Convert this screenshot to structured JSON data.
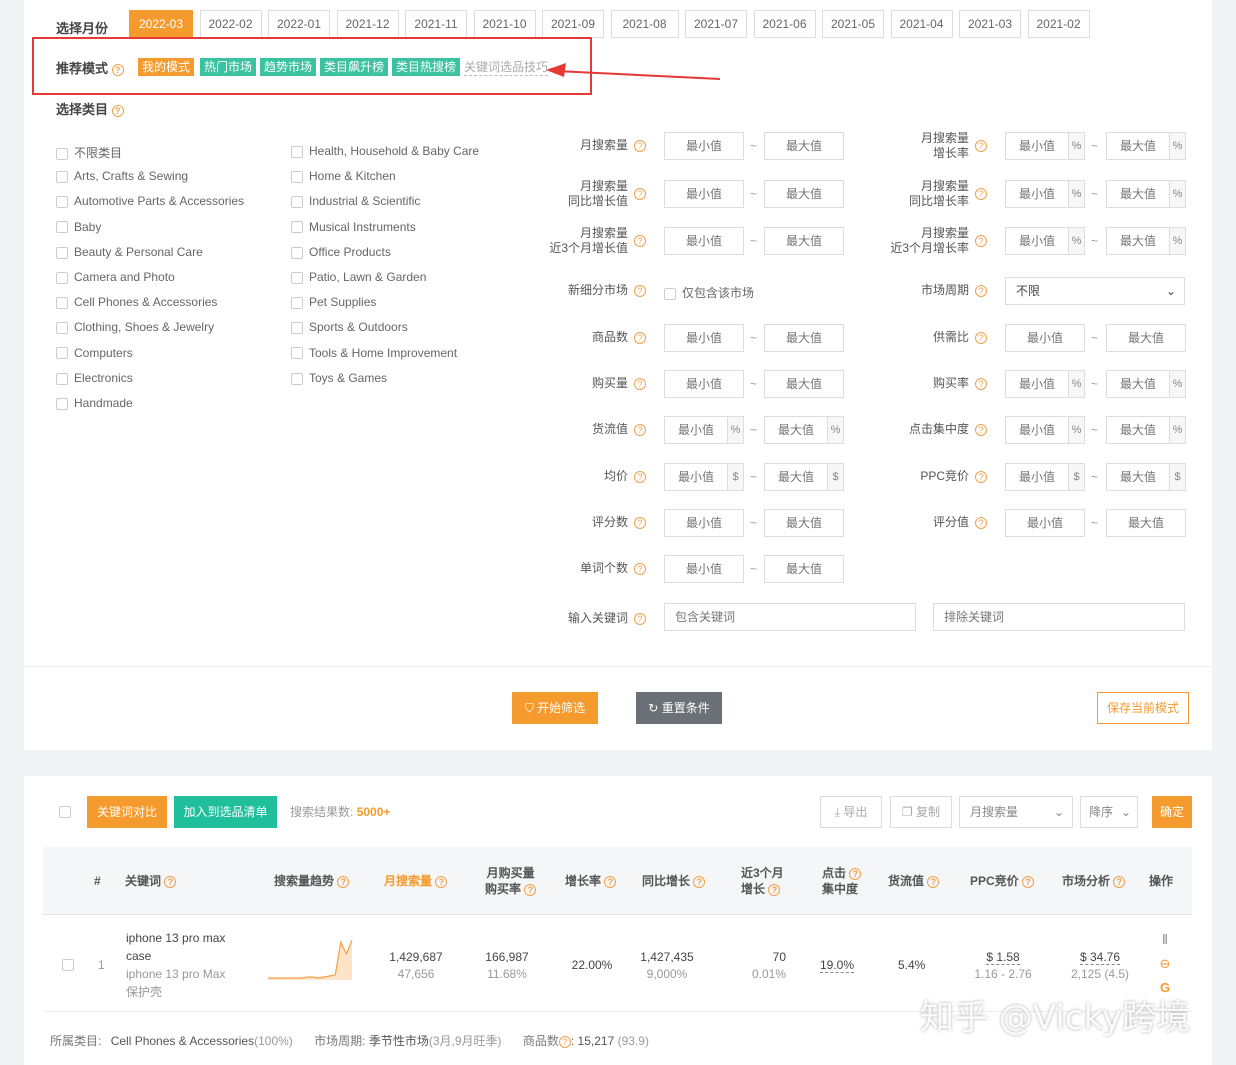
{
  "month": {
    "label": "选择月份",
    "options": [
      "2022-03",
      "2022-02",
      "2022-01",
      "2021-12",
      "2021-11",
      "2021-10",
      "2021-09",
      "2021-08",
      "2021-07",
      "2021-06",
      "2021-05",
      "2021-04",
      "2021-03",
      "2021-02"
    ],
    "selected": "2022-03"
  },
  "recommend": {
    "label": "推荐模式",
    "tags": [
      "我的模式",
      "热门市场",
      "趋势市场",
      "类目飙升榜",
      "类目热搜榜"
    ],
    "tips": "关键词选品技巧"
  },
  "category": {
    "label": "选择类目",
    "col1": [
      "不限类目",
      "Arts, Crafts & Sewing",
      "Automotive Parts & Accessories",
      "Baby",
      "Beauty & Personal Care",
      "Camera and Photo",
      "Cell Phones & Accessories",
      "Clothing, Shoes & Jewelry",
      "Computers",
      "Electronics",
      "Handmade"
    ],
    "col2": [
      "Health, Household & Baby Care",
      "Home & Kitchen",
      "Industrial & Scientific",
      "Musical Instruments",
      "Office Products",
      "Patio, Lawn & Garden",
      "Pet Supplies",
      "Sports & Outdoors",
      "Tools & Home Improvement",
      "Toys & Games"
    ]
  },
  "filters": {
    "min": "最小值",
    "max": "最大值",
    "left": [
      {
        "label": "月搜索量"
      },
      {
        "label1": "月搜索量",
        "label2": "同比增长值"
      },
      {
        "label1": "月搜索量",
        "label2": "近3个月增长值"
      },
      {
        "label": "新细分市场",
        "checkbox": "仅包含该市场"
      },
      {
        "label": "商品数"
      },
      {
        "label": "购买量"
      },
      {
        "label": "货流值",
        "unit": "%"
      },
      {
        "label": "均价",
        "unit": "$"
      },
      {
        "label": "评分数"
      },
      {
        "label": "单词个数"
      }
    ],
    "right": [
      {
        "label1": "月搜索量",
        "label2": "增长率",
        "unit": "%"
      },
      {
        "label1": "月搜索量",
        "label2": "同比增长率",
        "unit": "%"
      },
      {
        "label1": "月搜索量",
        "label2": "近3个月增长率",
        "unit": "%"
      },
      {
        "label": "市场周期",
        "select": "不限"
      },
      {
        "label": "供需比"
      },
      {
        "label": "购买率",
        "unit": "%"
      },
      {
        "label": "点击集中度",
        "unit": "%"
      },
      {
        "label": "PPC竞价",
        "unit": "$"
      },
      {
        "label": "评分值"
      }
    ],
    "keyword_label": "输入关键词",
    "include_placeholder": "包含关键词",
    "exclude_placeholder": "排除关键词"
  },
  "actions": {
    "start": "开始筛选",
    "reset": "重置条件",
    "save": "保存当前模式"
  },
  "results": {
    "compare": "关键词对比",
    "add_list": "加入到选品清单",
    "count_label": "搜索结果数:",
    "count": "5000+",
    "export": "导出",
    "copy": "复制",
    "sort_field": "月搜索量",
    "sort_order": "降序",
    "confirm": "确定",
    "headers": {
      "index": "#",
      "keyword": "关键词",
      "trend": "搜索量趋势",
      "monthly": "月搜索量",
      "buy1": "月购买量",
      "buy2": "购买率",
      "growth": "增长率",
      "yoy": "同比增长",
      "m3a": "近3个月",
      "m3b": "增长",
      "click1": "点击",
      "click2": "集中度",
      "flow": "货流值",
      "ppc": "PPC竞价",
      "market": "市场分析",
      "ops": "操作"
    },
    "row": {
      "index": "1",
      "kw1": "iphone 13 pro max",
      "kw2": "case",
      "tr1": "iphone 13 pro Max",
      "tr2": "保护壳",
      "monthly": "1,429,687",
      "monthly_sub": "47,656",
      "buy": "166,987",
      "buy_rate": "11.68%",
      "growth": "22.00%",
      "yoy": "1,427,435",
      "yoy_sub": "9,000%",
      "m3": "70",
      "m3_sub": "0.01%",
      "click": "19.0%",
      "flow": "5.4%",
      "ppc": "$ 1.58",
      "ppc_range": "1.16 - 2.76",
      "market": "$ 34.76",
      "market_sub": "2,125 (4.5)",
      "trend": [
        2,
        2,
        2,
        2,
        2,
        2,
        2,
        3,
        3,
        2,
        3,
        4,
        5,
        38,
        26,
        40
      ]
    },
    "footer": {
      "cat_label": "所属类目:",
      "cat": "Cell Phones & Accessories",
      "cat_pct": "(100%)",
      "cycle_label": "市场周期:",
      "cycle": "季节性市场",
      "cycle_detail": "(3月,9月旺季)",
      "goods_label": "商品数",
      "goods": ": 15,217",
      "goods_sub": "(93.9)"
    }
  },
  "watermark": "知乎 @Vicky跨境",
  "colors": {
    "orange": "#f59a2c",
    "green": "#3bc2a0",
    "grey": "#6b7177",
    "red": "#e53935"
  }
}
